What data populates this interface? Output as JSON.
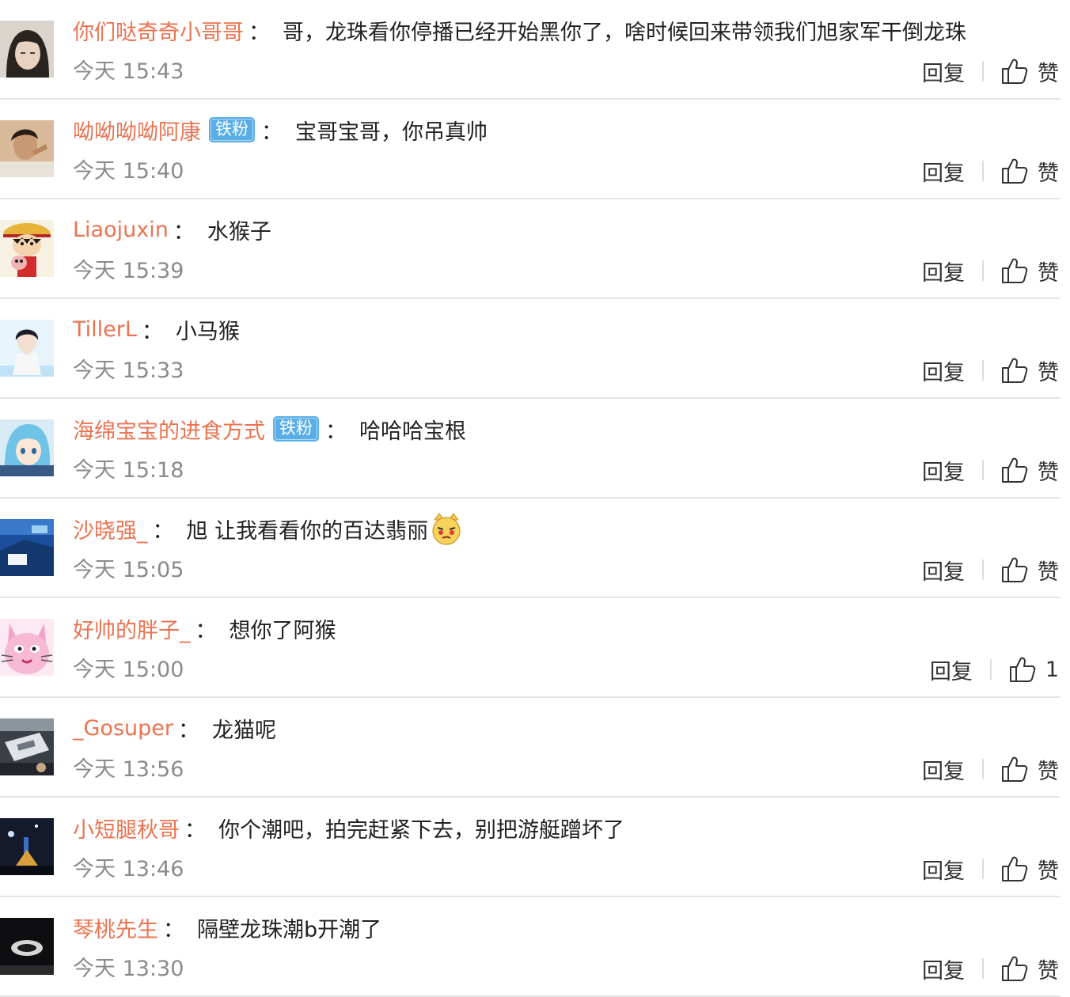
{
  "comments": [
    {
      "username": "你们哒奇奇小哥哥",
      "badge": "",
      "text": "哥，龙珠看你停播已经开始黑你了，啥时候回来带领我们旭家军干倒龙珠",
      "time": "今天 15:43",
      "reply": "回复",
      "like": "赞",
      "emoji": false
    },
    {
      "username": "呦呦呦呦阿康",
      "badge": "铁粉",
      "text": "宝哥宝哥，你吊真帅",
      "time": "今天 15:40",
      "reply": "回复",
      "like": "赞",
      "emoji": false
    },
    {
      "username": "Liaojuxin",
      "badge": "",
      "text": "水猴子",
      "time": "今天 15:39",
      "reply": "回复",
      "like": "赞",
      "emoji": false
    },
    {
      "username": "TillerL",
      "badge": "",
      "text": "小马猴",
      "time": "今天 15:33",
      "reply": "回复",
      "like": "赞",
      "emoji": false
    },
    {
      "username": "海绵宝宝的进食方式",
      "badge": "铁粉",
      "text": "哈哈哈宝根",
      "time": "今天 15:18",
      "reply": "回复",
      "like": "赞",
      "emoji": false
    },
    {
      "username": "沙晓强_",
      "badge": "",
      "text": "旭 让我看看你的百达翡丽",
      "time": "今天 15:05",
      "reply": "回复",
      "like": "赞",
      "emoji": true
    },
    {
      "username": "好帅的胖子_",
      "badge": "",
      "text": "想你了阿猴",
      "time": "今天 15:00",
      "reply": "回复",
      "like": "1",
      "emoji": false
    },
    {
      "username": "_Gosuper",
      "badge": "",
      "text": "龙猫呢",
      "time": "今天 13:56",
      "reply": "回复",
      "like": "赞",
      "emoji": false
    },
    {
      "username": "小短腿秋哥",
      "badge": "",
      "text": "你个潮吧，拍完赶紧下去，别把游艇蹭坏了",
      "time": "今天 13:46",
      "reply": "回复",
      "like": "赞",
      "emoji": false
    },
    {
      "username": "琴桃先生",
      "badge": "",
      "text": "隔壁龙珠潮b开潮了",
      "time": "今天 13:30",
      "reply": "回复",
      "like": "赞",
      "emoji": false
    }
  ],
  "colon": "：",
  "colors": {
    "username": "#eb7350",
    "time": "#8a8a8a",
    "badge": "#5aaee8",
    "divider": "#e4e4e4"
  },
  "avatars": [
    "girl-portrait",
    "man-portrait",
    "anime-pirate",
    "anime-boy",
    "anime-girl-blue-hair",
    "blue-photo",
    "pink-cat",
    "photo-device",
    "night-scene",
    "dark-photo"
  ]
}
